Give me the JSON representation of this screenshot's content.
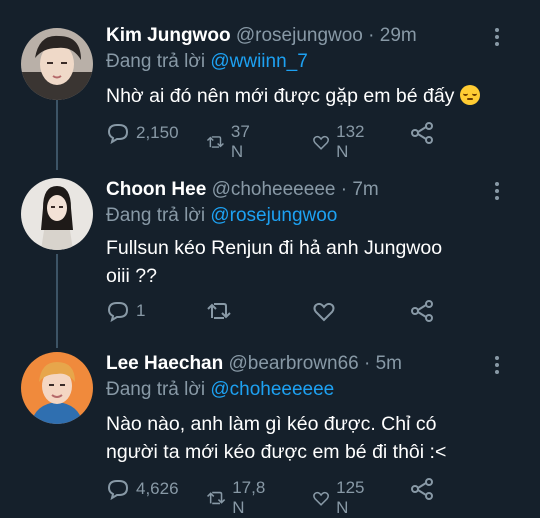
{
  "tweets": [
    {
      "name": "Kim Jungwoo",
      "handle": "@rosejungwoo",
      "time": "· 29m",
      "reply_prefix": "Đang trả lời",
      "reply_to": "@wwiinn_7",
      "text": "Nhờ ai đó nên mới được gặp em bé đấy",
      "emoji": "relieved-face-emoji",
      "replies": "2,150",
      "retweets": "37 N",
      "likes": "132 N"
    },
    {
      "name": "Choon Hee",
      "handle": "@choheeeeee",
      "time": "· 7m",
      "reply_prefix": "Đang trả lời",
      "reply_to": "@rosejungwoo",
      "text_line1": "Fullsun kéo Renjun đi hả anh Jungwoo",
      "text_line2": "oiii ??",
      "replies": "1",
      "retweets": "",
      "likes": ""
    },
    {
      "name": "Lee Haechan",
      "handle": "@bearbrown66",
      "time": "· 5m",
      "reply_prefix": "Đang trả lời",
      "reply_to": "@choheeeeee",
      "text_line1": "Nào nào, anh làm gì kéo được. Chỉ có",
      "text_line2": "người ta mới kéo được em bé đi thôi :<",
      "replies": "4,626",
      "retweets": "17,8 N",
      "likes": "125 N"
    }
  ],
  "colors": {
    "background": "#15202b",
    "muted": "#8899a6",
    "link": "#1da1f2",
    "thread": "#3d5466"
  }
}
